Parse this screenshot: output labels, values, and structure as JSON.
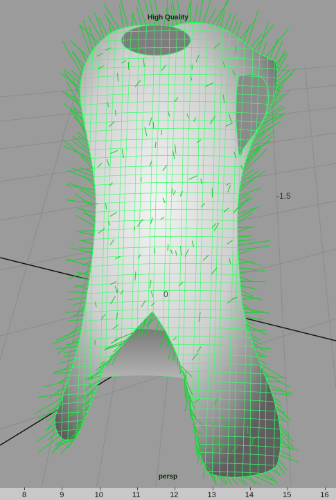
{
  "viewport": {
    "hud_title": "High Quality",
    "camera_label": "persp",
    "axis_label_negative": "-1.5",
    "axis_label_zero": "0",
    "colors": {
      "background": "#9b9b9b",
      "grid": "#8a8a8a",
      "wire": "#33ff66",
      "normals": "#1fd636",
      "surface": "#d8d8d8"
    },
    "mesh_icon": "cloth-mesh-with-normals"
  },
  "timeslider": {
    "ticks": [
      "8",
      "9",
      "10",
      "11",
      "12",
      "13",
      "14",
      "15",
      "16"
    ]
  }
}
